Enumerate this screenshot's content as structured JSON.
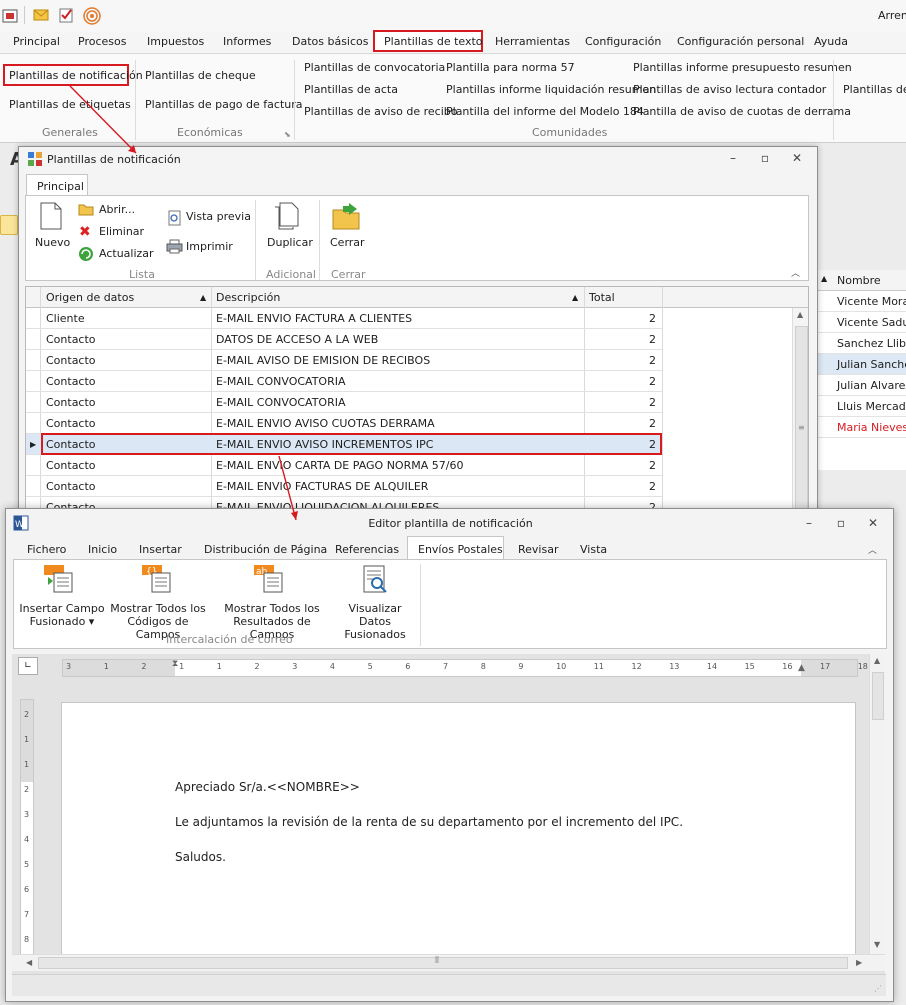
{
  "app": {
    "top_right_text": "Arren",
    "menu": [
      "Principal",
      "Procesos",
      "Impuestos",
      "Informes",
      "Datos básicos",
      "Plantillas de texto",
      "Herramientas",
      "Configuración",
      "Configuración personal",
      "Ayuda"
    ],
    "ribbon": {
      "generales": [
        "Plantillas de notificación",
        "Plantillas de etiquetas"
      ],
      "economicas": [
        "Plantillas de cheque",
        "Plantillas de pago de factura"
      ],
      "comunidades": [
        "Plantillas de convocatoria",
        "Plantillas de acta",
        "Plantillas de aviso de recibo",
        "Plantilla para norma 57",
        "Plantillas informe liquidación resumen",
        "Plantilla del informe del Modelo 184",
        "Plantillas informe presupuesto resumen",
        "Plantillas de aviso lectura contador",
        "Plantilla de aviso de cuotas de derrama"
      ],
      "extra": "Plantillas de f",
      "groups": [
        "Generales",
        "Económicas",
        "Comunidades"
      ]
    },
    "body_letter": "A",
    "right_list": {
      "header": "Nombre",
      "rows": [
        "Vicente Mora P",
        "Vicente Sadurr",
        "Sanchez Llibre",
        "Julian Sanchez",
        "Julian Alvarez",
        "Lluis Mercade E",
        "Maria Nieves F"
      ]
    }
  },
  "w1": {
    "title": "Plantillas de notificación",
    "tab": "Principal",
    "buttons": {
      "nuevo": "Nuevo",
      "abrir": "Abrir...",
      "eliminar": "Eliminar",
      "actualizar": "Actualizar",
      "vista_previa": "Vista previa",
      "imprimir": "Imprimir",
      "duplicar": "Duplicar",
      "cerrar": "Cerrar"
    },
    "groups": [
      "Lista",
      "Adicional",
      "Cerrar"
    ],
    "columns": [
      "Origen de datos",
      "Descripción",
      "Total"
    ],
    "rows": [
      [
        "Cliente",
        "E-MAIL ENVIO FACTURA A CLIENTES",
        "2"
      ],
      [
        "Contacto",
        "DATOS DE ACCESO A LA WEB",
        "2"
      ],
      [
        "Contacto",
        "E-MAIL AVISO DE EMISION DE RECIBOS",
        "2"
      ],
      [
        "Contacto",
        "E-MAIL CONVOCATORIA",
        "2"
      ],
      [
        "Contacto",
        "E-MAIL CONVOCATORIA",
        "2"
      ],
      [
        "Contacto",
        "E-MAIL ENVIO AVISO CUOTAS DERRAMA",
        "2"
      ],
      [
        "Contacto",
        "E-MAIL ENVIO AVISO INCREMENTOS IPC",
        "2"
      ],
      [
        "Contacto",
        "E-MAIL ENVIO CARTA DE PAGO NORMA 57/60",
        "2"
      ],
      [
        "Contacto",
        "E-MAIL ENVIO FACTURAS DE ALQUILER",
        "2"
      ],
      [
        "Contacto",
        "E-MAIL ENVIO LIQUIDACION ALQUILERES",
        "2"
      ]
    ]
  },
  "w2": {
    "title": "Editor plantilla de notificación",
    "tabs": [
      "Fichero",
      "Inicio",
      "Insertar",
      "Distribución de Página",
      "Referencias",
      "Envíos Postales",
      "Revisar",
      "Vista"
    ],
    "buttons": [
      [
        "Insertar Campo",
        "Fusionado ▾"
      ],
      [
        "Mostrar Todos los",
        "Códigos de Campos"
      ],
      [
        "Mostrar Todos los",
        "Resultados de Campos"
      ],
      [
        "Visualizar Datos",
        "Fusionados"
      ]
    ],
    "group": "Intercalación de correo",
    "ruler": [
      "3",
      "1",
      "2",
      "1",
      "1",
      "2",
      "3",
      "4",
      "5",
      "6",
      "7",
      "8",
      "9",
      "10",
      "11",
      "12",
      "13",
      "14",
      "15",
      "16",
      "17",
      "18"
    ],
    "vruler": [
      "2",
      "1",
      "1",
      "2",
      "3",
      "4",
      "5",
      "6",
      "7",
      "8"
    ],
    "doc": [
      "Apreciado Sr/a.<<NOMBRE>>",
      "Le adjuntamos la revisión de la renta de su departamento por el incremento del IPC.",
      "Saludos."
    ]
  },
  "colors": {
    "highlight": "#d71920",
    "accent": "#2b6cb0"
  }
}
